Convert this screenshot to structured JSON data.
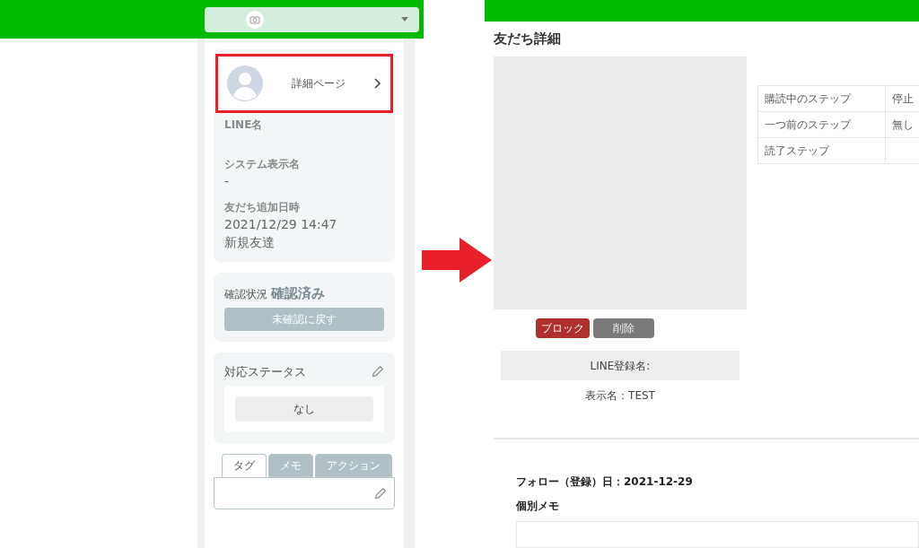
{
  "left": {
    "profile": {
      "link": "詳細ページ"
    },
    "fields": [
      {
        "label": "LINE名"
      },
      {
        "label": "システム表示名",
        "lines": [
          "-"
        ]
      },
      {
        "label": "友だち追加日時",
        "lines": [
          "2021/12/29 14:47",
          "新規友達"
        ]
      }
    ],
    "confirm": {
      "label": "確認状況",
      "value": "確認済み",
      "button": "未確認に戻す"
    },
    "status": {
      "title": "対応ステータス",
      "value": "なし"
    },
    "tabs": [
      {
        "label": "タグ",
        "selected": true
      },
      {
        "label": "メモ",
        "selected": false
      },
      {
        "label": "アクション",
        "selected": false
      }
    ]
  },
  "right": {
    "title": "友だち詳細",
    "steps": [
      [
        "購読中のステップ",
        "停止"
      ],
      [
        "一つ前のステップ",
        "無し"
      ],
      [
        "読了ステップ"
      ]
    ],
    "buttons": [
      {
        "label": "ブロック",
        "kind": "danger"
      },
      {
        "label": "削除",
        "kind": "neutral"
      }
    ],
    "line_name_label": "LINE登録名:",
    "display_name": "表示名：TEST",
    "follow_date": "フォロー（登録）日：2021-12-29",
    "memo_title": "個別メモ"
  }
}
